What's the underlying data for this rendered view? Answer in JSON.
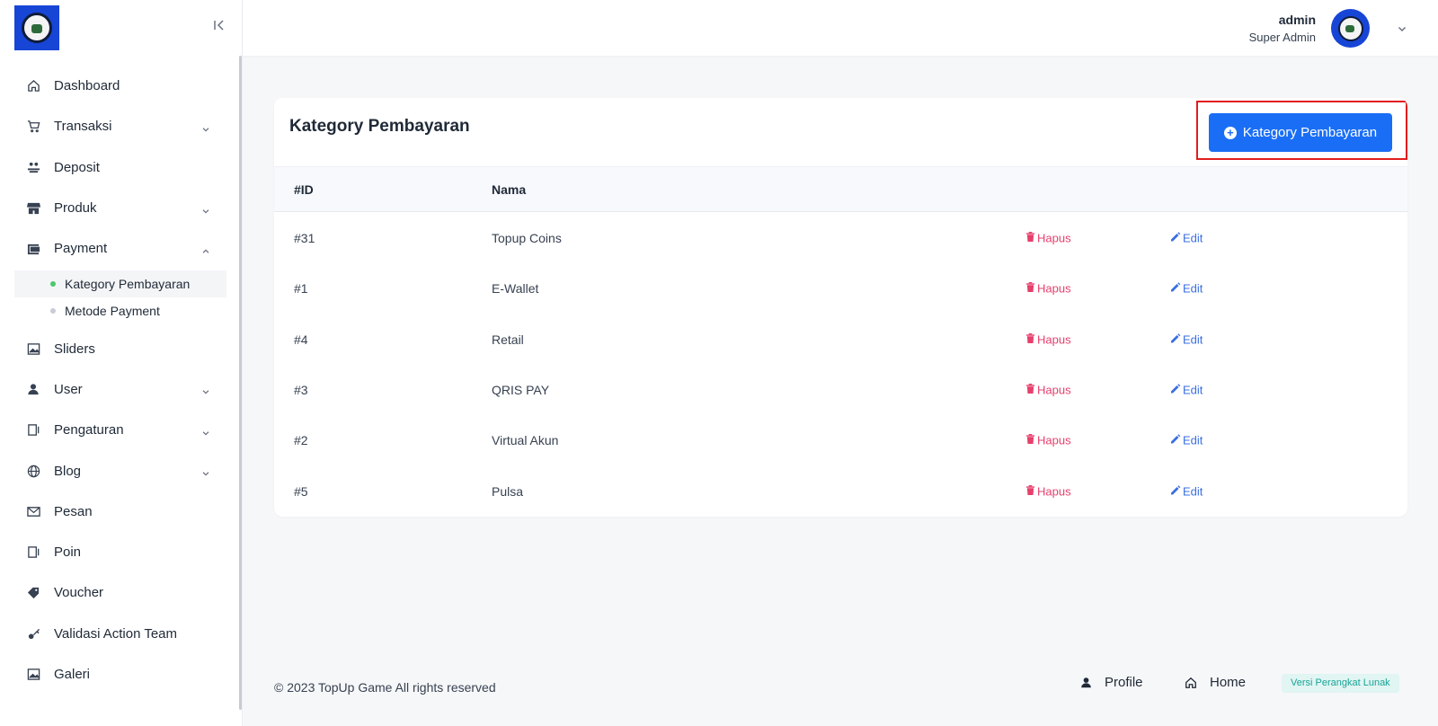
{
  "sidebar": {
    "logo_alt": "TopUp Game logo",
    "items": [
      {
        "label": "Dashboard",
        "icon": "home-icon",
        "has_chevron": false
      },
      {
        "label": "Transaksi",
        "icon": "cart-icon",
        "has_chevron": true
      },
      {
        "label": "Deposit",
        "icon": "coins-icon",
        "has_chevron": false
      },
      {
        "label": "Produk",
        "icon": "store-icon",
        "has_chevron": true
      },
      {
        "label": "Payment",
        "icon": "wallet-icon",
        "has_chevron": true,
        "expanded": true,
        "children": [
          {
            "label": "Kategory Pembayaran",
            "active": true
          },
          {
            "label": "Metode Payment",
            "active": false
          }
        ]
      },
      {
        "label": "Sliders",
        "icon": "image-icon",
        "has_chevron": false
      },
      {
        "label": "User",
        "icon": "user-icon",
        "has_chevron": true
      },
      {
        "label": "Pengaturan",
        "icon": "panel-icon",
        "has_chevron": true
      },
      {
        "label": "Blog",
        "icon": "globe-icon",
        "has_chevron": true
      },
      {
        "label": "Pesan",
        "icon": "mail-icon",
        "has_chevron": false
      },
      {
        "label": "Poin",
        "icon": "panel-icon",
        "has_chevron": false
      },
      {
        "label": "Voucher",
        "icon": "tag-icon",
        "has_chevron": false
      },
      {
        "label": "Validasi Action Team",
        "icon": "key-icon",
        "has_chevron": false
      },
      {
        "label": "Galeri",
        "icon": "image-icon",
        "has_chevron": false
      }
    ]
  },
  "header": {
    "user_name": "admin",
    "user_role": "Super Admin"
  },
  "card": {
    "title": "Kategory Pembayaran",
    "add_button_label": "Kategory Pembayaran",
    "columns": [
      "#ID",
      "Nama"
    ],
    "delete_label": "Hapus",
    "edit_label": "Edit",
    "rows": [
      {
        "id": "#31",
        "name": "Topup Coins"
      },
      {
        "id": "#1",
        "name": "E-Wallet"
      },
      {
        "id": "#4",
        "name": "Retail"
      },
      {
        "id": "#3",
        "name": "QRIS PAY"
      },
      {
        "id": "#2",
        "name": "Virtual Akun"
      },
      {
        "id": "#5",
        "name": "Pulsa"
      }
    ]
  },
  "footer": {
    "copyright": "© 2023 TopUp Game All rights reserved",
    "profile_label": "Profile",
    "home_label": "Home",
    "version_label": "Versi Perangkat Lunak"
  },
  "colors": {
    "primary": "#1a6ef5",
    "danger": "#e73f6c",
    "edit": "#3b6fe0",
    "active_dot": "#4cc96d",
    "highlight": "#e11d1d"
  }
}
